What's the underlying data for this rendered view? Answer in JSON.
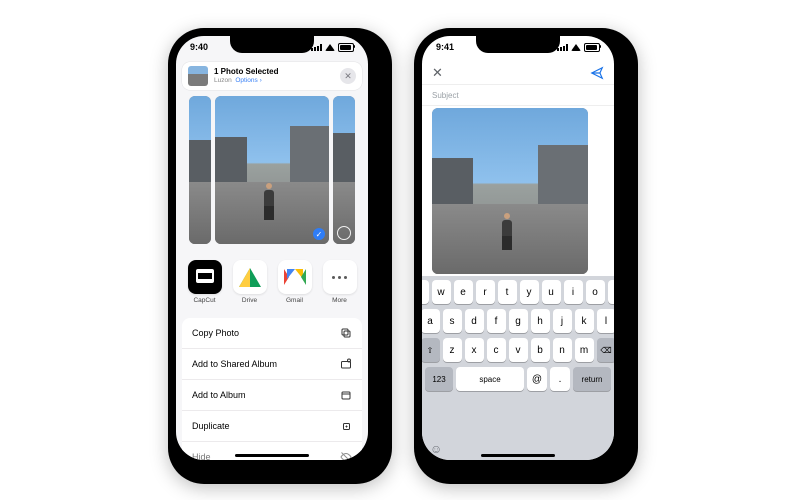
{
  "left": {
    "status_time": "9:40",
    "header": {
      "title": "1 Photo Selected",
      "subtitle_location": "Luzon",
      "options_label": "Options",
      "options_chevron": "›"
    },
    "apps": [
      {
        "name": "capcut",
        "label": "CapCut"
      },
      {
        "name": "drive",
        "label": "Drive"
      },
      {
        "name": "gmail",
        "label": "Gmail"
      },
      {
        "name": "more",
        "label": "More"
      }
    ],
    "actions": [
      {
        "label": "Copy Photo",
        "icon": "copy"
      },
      {
        "label": "Add to Shared Album",
        "icon": "shared-album"
      },
      {
        "label": "Add to Album",
        "icon": "album"
      },
      {
        "label": "Duplicate",
        "icon": "duplicate"
      },
      {
        "label": "Hide",
        "icon": "hide"
      }
    ]
  },
  "right": {
    "status_time": "9:41",
    "subject_placeholder": "Subject",
    "keyboard": {
      "row1": [
        "q",
        "w",
        "e",
        "r",
        "t",
        "y",
        "u",
        "i",
        "o",
        "p"
      ],
      "row2": [
        "a",
        "s",
        "d",
        "f",
        "g",
        "h",
        "j",
        "k",
        "l"
      ],
      "row3_letters": [
        "z",
        "x",
        "c",
        "v",
        "b",
        "n",
        "m"
      ],
      "fn_123": "123",
      "fn_space": "space",
      "fn_at": "@",
      "fn_dot": ".",
      "fn_return": "return",
      "shift_glyph": "⇧",
      "del_glyph": "⌫",
      "emoji_glyph": "☺"
    }
  }
}
